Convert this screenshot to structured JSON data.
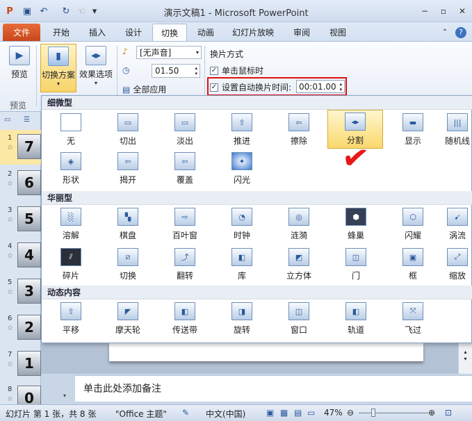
{
  "window": {
    "title": "演示文稿1 - Microsoft PowerPoint"
  },
  "tabs": [
    "文件",
    "开始",
    "插入",
    "设计",
    "切换",
    "动画",
    "幻灯片放映",
    "审阅",
    "视图"
  ],
  "ribbon": {
    "preview_label": "预览",
    "preview_group": "预览",
    "scheme_label": "切换方案",
    "effect_label": "效果选项",
    "sound_value": "[无声音]",
    "duration_value": "01.50",
    "apply_all_label": "全部应用",
    "advance_title": "换片方式",
    "on_click_label": "单击鼠标时",
    "after_time_label": "设置自动换片时间:",
    "after_time_value": "00:01.00"
  },
  "gallery": {
    "categories": [
      "细微型",
      "华丽型",
      "动态内容"
    ],
    "subtle": [
      "无",
      "切出",
      "淡出",
      "推进",
      "擦除",
      "分割",
      "显示",
      "随机线",
      "形状",
      "揭开",
      "覆盖",
      "闪光"
    ],
    "exciting": [
      "溶解",
      "棋盘",
      "百叶窗",
      "时钟",
      "涟漪",
      "蜂巢",
      "闪耀",
      "涡流",
      "碎片",
      "切换",
      "翻转",
      "库",
      "立方体",
      "门",
      "框",
      "缩放"
    ],
    "dynamic": [
      "平移",
      "摩天轮",
      "传送带",
      "旋转",
      "窗口",
      "轨道",
      "飞过"
    ]
  },
  "slides": [
    {
      "num": "1",
      "label": "7"
    },
    {
      "num": "2",
      "label": "6"
    },
    {
      "num": "3",
      "label": "5"
    },
    {
      "num": "4",
      "label": "4"
    },
    {
      "num": "5",
      "label": "3"
    },
    {
      "num": "6",
      "label": "2"
    },
    {
      "num": "7",
      "label": "1"
    },
    {
      "num": "8",
      "label": "0"
    }
  ],
  "notes_placeholder": "单击此处添加备注",
  "status": {
    "slide_info": "幻灯片 第 1 张，共 8 张",
    "theme": "\"Office 主题\"",
    "language": "中文(中国)",
    "zoom": "47%"
  },
  "colors": {
    "file_tab": "#d0521f",
    "highlight": "#f9d86c",
    "annotation": "#e01010"
  }
}
